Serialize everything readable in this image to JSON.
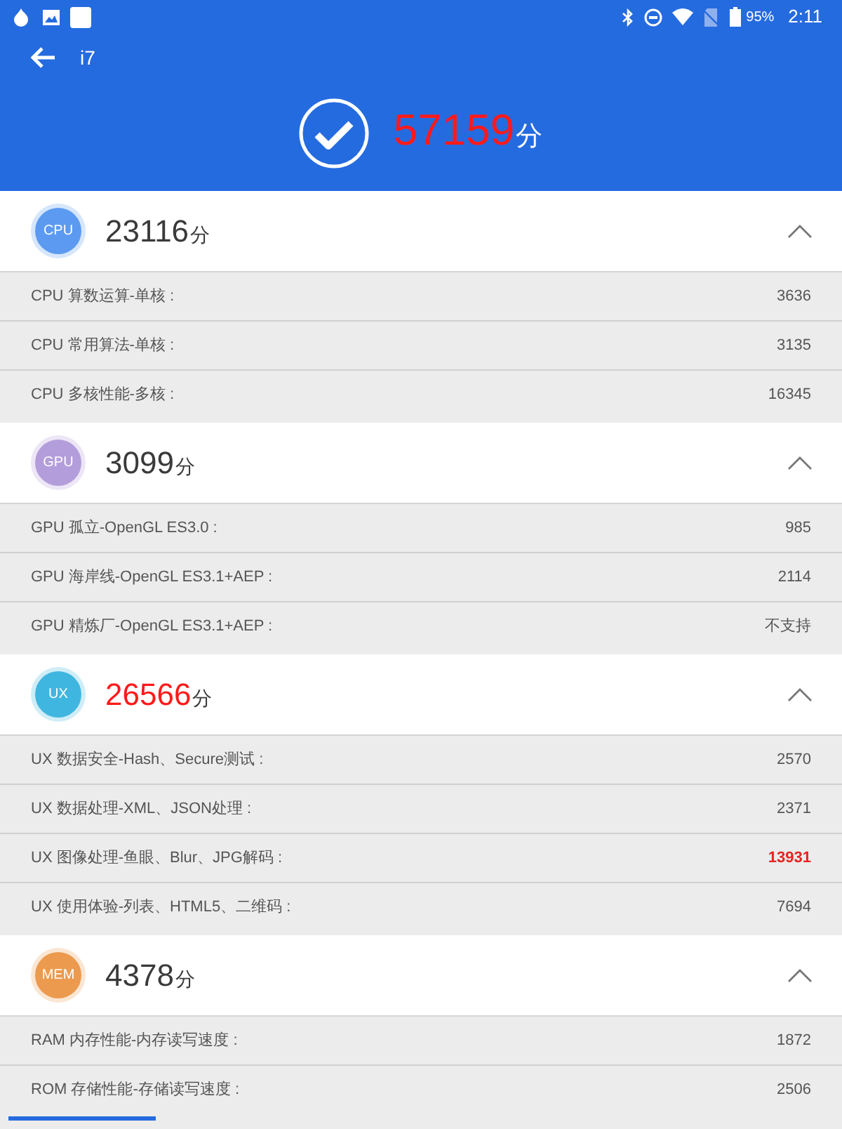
{
  "status_bar": {
    "battery": "95%",
    "time": "2:11"
  },
  "app_bar": {
    "title": "i7"
  },
  "total": {
    "score": "57159",
    "unit": "分",
    "highlight": true
  },
  "sections": [
    {
      "badge": "CPU",
      "color": "#5b9af0",
      "score": "23116",
      "unit": "分",
      "highlight": false,
      "expanded": true,
      "rows": [
        {
          "label": "CPU 算数运算-单核 :",
          "value": "3636",
          "highlight": false
        },
        {
          "label": "CPU 常用算法-单核 :",
          "value": "3135",
          "highlight": false
        },
        {
          "label": "CPU 多核性能-多核 :",
          "value": "16345",
          "highlight": false
        }
      ]
    },
    {
      "badge": "GPU",
      "color": "#b39ddb",
      "score": "3099",
      "unit": "分",
      "highlight": false,
      "expanded": true,
      "rows": [
        {
          "label": "GPU 孤立-OpenGL ES3.0 :",
          "value": "985",
          "highlight": false
        },
        {
          "label": "GPU 海岸线-OpenGL ES3.1+AEP :",
          "value": "2114",
          "highlight": false
        },
        {
          "label": "GPU 精炼厂-OpenGL ES3.1+AEP :",
          "value": "不支持",
          "highlight": false
        }
      ]
    },
    {
      "badge": "UX",
      "color": "#3fb6e0",
      "score": "26566",
      "unit": "分",
      "highlight": true,
      "expanded": true,
      "rows": [
        {
          "label": "UX 数据安全-Hash、Secure测试 :",
          "value": "2570",
          "highlight": false
        },
        {
          "label": "UX 数据处理-XML、JSON处理 :",
          "value": "2371",
          "highlight": false
        },
        {
          "label": "UX 图像处理-鱼眼、Blur、JPG解码 :",
          "value": "13931",
          "highlight": true
        },
        {
          "label": "UX 使用体验-列表、HTML5、二维码 :",
          "value": "7694",
          "highlight": false
        }
      ]
    },
    {
      "badge": "MEM",
      "color": "#eb9a4e",
      "score": "4378",
      "unit": "分",
      "highlight": false,
      "expanded": true,
      "rows": [
        {
          "label": "RAM 内存性能-内存读写速度 :",
          "value": "1872",
          "highlight": false
        },
        {
          "label": "ROM 存储性能-存储读写速度 :",
          "value": "2506",
          "highlight": false
        }
      ]
    }
  ]
}
